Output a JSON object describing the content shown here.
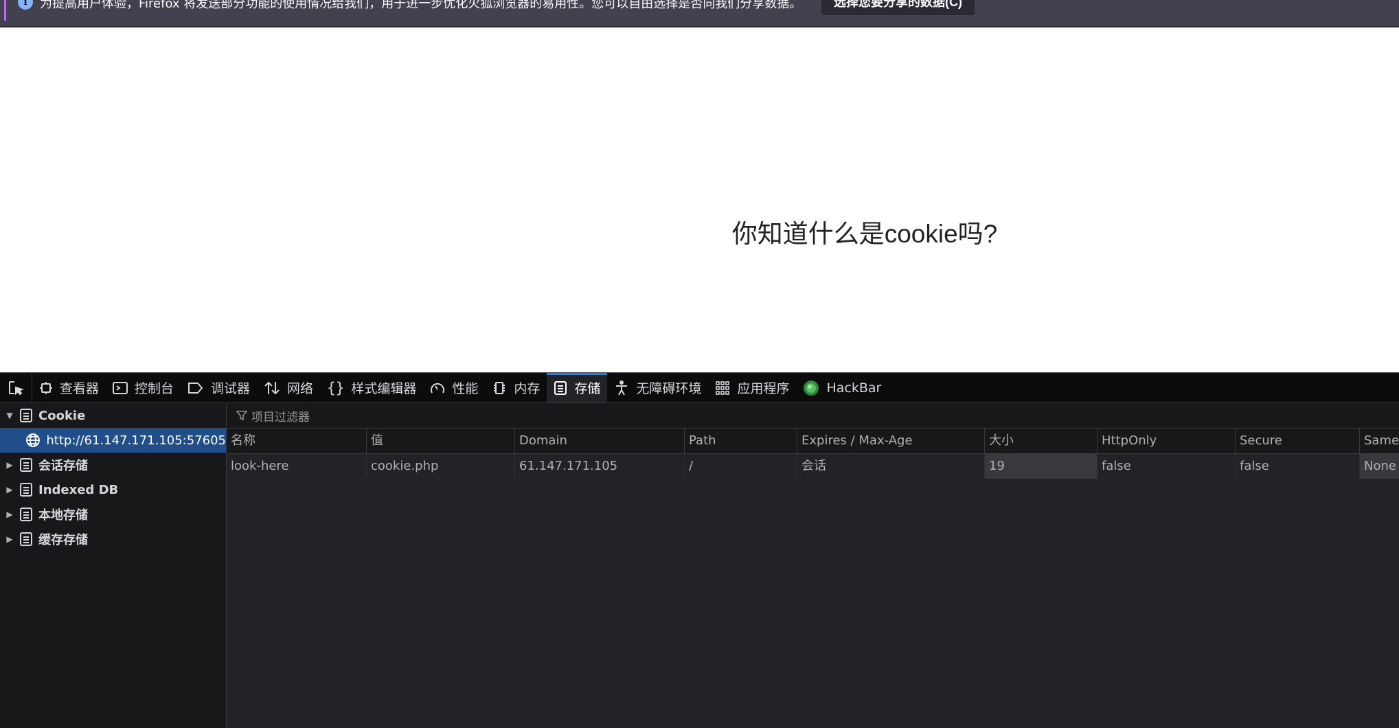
{
  "notification": {
    "text": "为提高用户体验，Firefox 将发送部分功能的使用情况给我们，用于进一步优化火狐浏览器的易用性。您可以自由选择是否向我们分享数据。",
    "button_label": "选择您要分享的数据(C)",
    "icon": "info-icon"
  },
  "page": {
    "heading": "你知道什么是cookie吗?"
  },
  "devtools": {
    "tabs": [
      {
        "label": "查看器",
        "icon": "inspector-icon"
      },
      {
        "label": "控制台",
        "icon": "console-icon"
      },
      {
        "label": "调试器",
        "icon": "debugger-icon"
      },
      {
        "label": "网络",
        "icon": "network-icon"
      },
      {
        "label": "样式编辑器",
        "icon": "style-editor-icon"
      },
      {
        "label": "性能",
        "icon": "performance-icon"
      },
      {
        "label": "内存",
        "icon": "memory-icon"
      },
      {
        "label": "存储",
        "icon": "storage-icon",
        "active": true
      },
      {
        "label": "无障碍环境",
        "icon": "accessibility-icon"
      },
      {
        "label": "应用程序",
        "icon": "application-icon"
      },
      {
        "label": "HackBar",
        "icon": "hackbar-icon"
      }
    ],
    "sidebar": {
      "items": [
        {
          "label": "Cookie",
          "expanded": true
        },
        {
          "label": "http://61.147.171.105:57605",
          "selected": true
        },
        {
          "label": "会话存储"
        },
        {
          "label": "Indexed DB"
        },
        {
          "label": "本地存储"
        },
        {
          "label": "缓存存储"
        }
      ]
    },
    "filter": {
      "placeholder": "项目过滤器"
    },
    "table": {
      "columns": [
        "名称",
        "值",
        "Domain",
        "Path",
        "Expires / Max-Age",
        "大小",
        "HttpOnly",
        "Secure",
        "SameS"
      ],
      "rows": [
        [
          "look-here",
          "cookie.php",
          "61.147.171.105",
          "/",
          "会话",
          "19",
          "false",
          "false",
          "None"
        ]
      ]
    },
    "colors": {
      "accent": "#0a84ff",
      "selected_bg": "#204e8a",
      "panel_bg": "#232327"
    }
  }
}
